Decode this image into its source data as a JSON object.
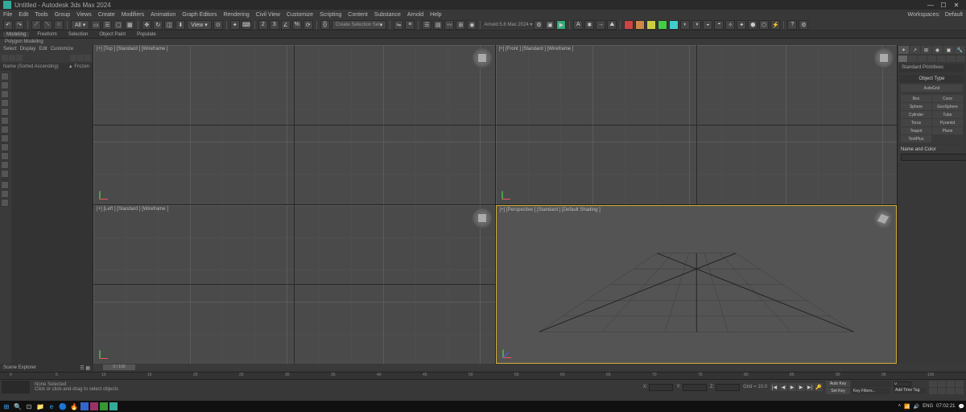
{
  "window": {
    "title": "Untitled - Autodesk 3ds Max 2024",
    "workspace": "Workspaces:",
    "default": "Default"
  },
  "menu": [
    "File",
    "Edit",
    "Tools",
    "Group",
    "Views",
    "Create",
    "Modifiers",
    "Animation",
    "Graph Editors",
    "Rendering",
    "Civil View",
    "Customize",
    "Scripting",
    "Content",
    "Substance",
    "Arnold",
    "Help"
  ],
  "toolbar": {
    "selection_set": "Create Selection Set",
    "snap": "3"
  },
  "ribbon": {
    "tabs": [
      "Modeling",
      "Freeform",
      "Selection",
      "Object Paint",
      "Populate"
    ],
    "active": 0,
    "sub": "Polygon Modeling"
  },
  "scene_explorer": {
    "tabs": [
      "Select",
      "Display",
      "Edit",
      "Customize"
    ],
    "sort": "Name (Sorted Ascending)",
    "col": "▲ Frozen",
    "footer": "Scene Explorer"
  },
  "viewports": {
    "top": "[+] [Top ] [Standard ] [Wireframe ]",
    "front": "[+] [Front ] [Standard ] [Wireframe ]",
    "left": "[+] [Left ] [Standard ] [Wireframe ]",
    "persp": "[+] [Perspective ] [Standard ] [Default Shading ]"
  },
  "command_panel": {
    "dropdown": "Standard Primitives",
    "rollout": "Object Type",
    "autogrid": "AutoGrid",
    "buttons": [
      "Box",
      "Cone",
      "Sphere",
      "GeoSphere",
      "Cylinder",
      "Tube",
      "Torus",
      "Pyramid",
      "Teapot",
      "Plane",
      "TextPlus"
    ],
    "name_color": "Name and Color",
    "swatch": "#d946a6"
  },
  "timeline": {
    "current": "0 / 100",
    "ticks": [
      0,
      5,
      10,
      15,
      20,
      25,
      30,
      35,
      40,
      45,
      50,
      55,
      60,
      65,
      70,
      75,
      80,
      85,
      90,
      95,
      100
    ]
  },
  "status": {
    "line1": "None Selected",
    "line2": "Click or click-and-drag to select objects",
    "x": "X:",
    "y": "Y:",
    "z": "Z:",
    "grid": "Grid = 10.0",
    "autokey": "Auto Key",
    "setkey": "Set Key",
    "filters": "Key Filters...",
    "addtime": "Add Time Tag",
    "frame": "0"
  },
  "taskbar": {
    "time": "07:02:21",
    "date": "",
    "lang": "ENG"
  }
}
